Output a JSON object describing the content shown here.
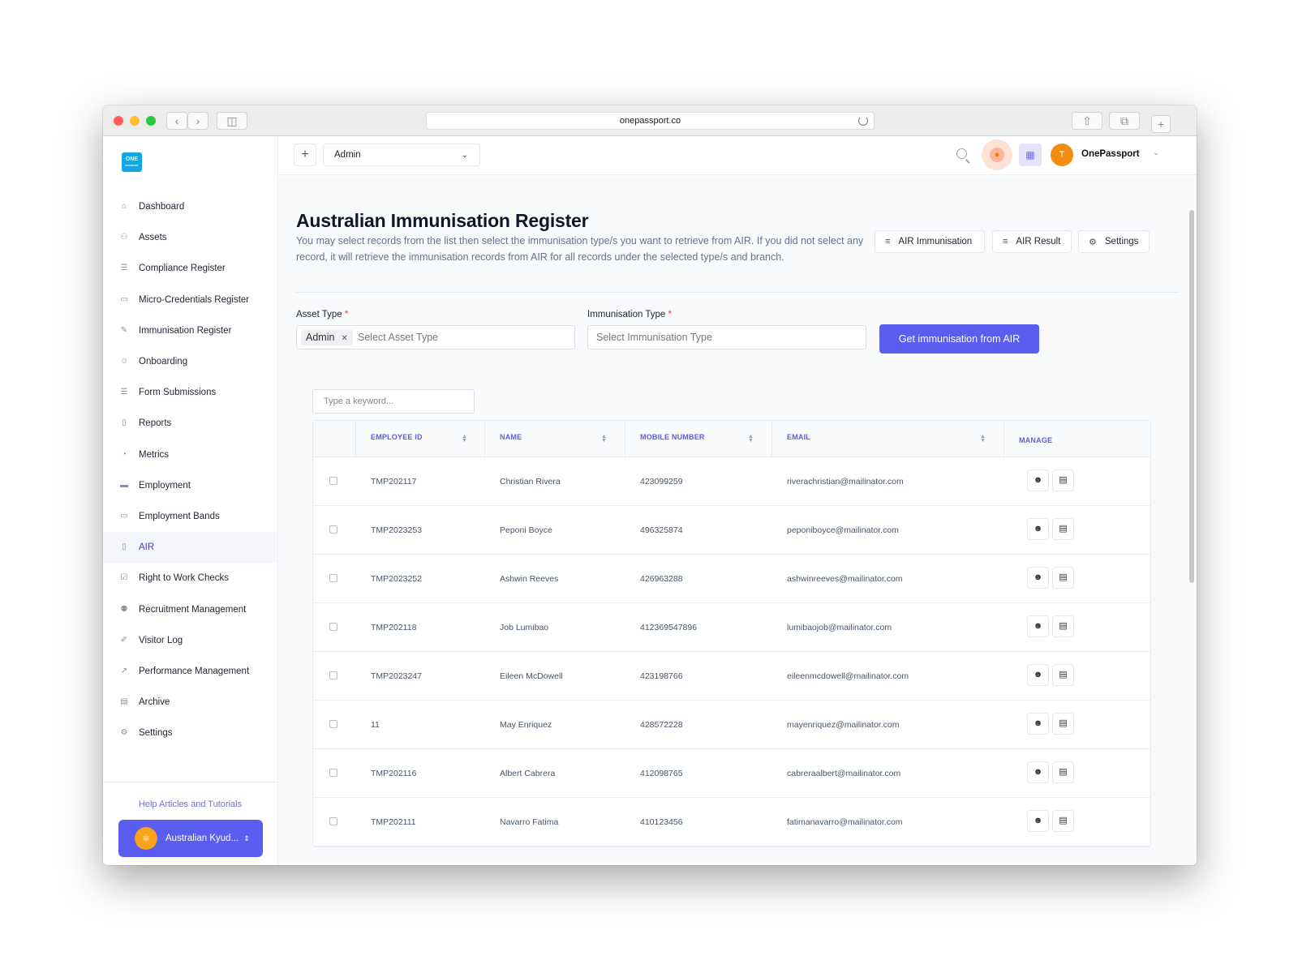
{
  "browser": {
    "url": "onepassport.co"
  },
  "logo": {
    "text": "ONE",
    "subtext": "PASSPORT"
  },
  "sidebar": {
    "items": [
      {
        "label": "Dashboard",
        "icon": "home-icon",
        "glyph": "⌂"
      },
      {
        "label": "Assets",
        "icon": "users-icon",
        "glyph": "⚇"
      },
      {
        "label": "Compliance Register",
        "icon": "list-icon",
        "glyph": "☰"
      },
      {
        "label": "Micro-Credentials Register",
        "icon": "card-icon",
        "glyph": "▭"
      },
      {
        "label": "Immunisation Register",
        "icon": "syringe-icon",
        "glyph": "✎"
      },
      {
        "label": "Onboarding",
        "icon": "user-plus-icon",
        "glyph": "☺"
      },
      {
        "label": "Form Submissions",
        "icon": "list-icon",
        "glyph": "☰"
      },
      {
        "label": "Reports",
        "icon": "document-icon",
        "glyph": "▯"
      },
      {
        "label": "Metrics",
        "icon": "pie-chart-icon",
        "glyph": "◔"
      },
      {
        "label": "Employment",
        "icon": "briefcase-icon",
        "glyph": "▬"
      },
      {
        "label": "Employment Bands",
        "icon": "briefcase-outline-icon",
        "glyph": "▭"
      },
      {
        "label": "AIR",
        "icon": "file-icon",
        "glyph": "▯"
      },
      {
        "label": "Right to Work Checks",
        "icon": "clipboard-check-icon",
        "glyph": "☑"
      },
      {
        "label": "Recruitment Management",
        "icon": "team-icon",
        "glyph": "⚉"
      },
      {
        "label": "Visitor Log",
        "icon": "pen-icon",
        "glyph": "✐"
      },
      {
        "label": "Performance Management",
        "icon": "line-chart-icon",
        "glyph": "↗"
      },
      {
        "label": "Archive",
        "icon": "archive-icon",
        "glyph": "▤"
      },
      {
        "label": "Settings",
        "icon": "gear-icon",
        "glyph": "⚙"
      }
    ],
    "active": "AIR",
    "help_link": "Help Articles and Tutorials",
    "org_name": "Australian Kyud..."
  },
  "topbar": {
    "plus": "+",
    "selector_value": "Admin",
    "user_initial": "T",
    "user_name": "OnePassport"
  },
  "page": {
    "title": "Australian Immunisation Register",
    "description": "You may select records from the list then select the immunisation type/s you want to retrieve from AIR. If you did not select any record, it will retrieve the immunisation records from AIR for all records under the selected type/s and branch.",
    "buttons": {
      "air_immunisation": "AIR Immunisation",
      "air_result": "AIR Result",
      "settings": "Settings"
    }
  },
  "form": {
    "asset_type_label": "Asset Type",
    "asset_type_chip": "Admin",
    "asset_type_placeholder": "Select Asset Type",
    "immunisation_type_label": "Immunisation Type",
    "immunisation_type_placeholder": "Select Immunisation Type",
    "required_mark": "*",
    "submit_label": "Get immunisation from AIR"
  },
  "search": {
    "placeholder": "Type a keyword..."
  },
  "table": {
    "headers": {
      "employee_id": "EMPLOYEE ID",
      "name": "NAME",
      "mobile": "MOBILE NUMBER",
      "email": "EMAIL",
      "manage": "MANAGE"
    },
    "rows": [
      {
        "id": "TMP202117",
        "name": "Christian Rivera",
        "mobile": "423099259",
        "email": "riverachristian@mailinator.com"
      },
      {
        "id": "TMP2023253",
        "name": "Peponi Boyce",
        "mobile": "496325874",
        "email": "peponiboyce@mailinator.com"
      },
      {
        "id": "TMP2023252",
        "name": "Ashwin Reeves",
        "mobile": "426963288",
        "email": "ashwinreeves@mailinator.com"
      },
      {
        "id": "TMP202118",
        "name": "Job Lumibao",
        "mobile": "412369547896",
        "email": "lumibaojob@mailinator.com"
      },
      {
        "id": "TMP2023247",
        "name": "Eileen McDowell",
        "mobile": "423198766",
        "email": "eileenmcdowell@mailinator.com"
      },
      {
        "id": "11",
        "name": "May Enriquez",
        "mobile": "428572228",
        "email": "mayenriquez@mailinator.com"
      },
      {
        "id": "TMP202116",
        "name": "Albert Cabrera",
        "mobile": "412098765",
        "email": "cabreraalbert@mailinator.com"
      },
      {
        "id": "TMP202111",
        "name": "Navarro Fatima",
        "mobile": "410123456",
        "email": "fatimanavarro@mailinator.com"
      }
    ]
  },
  "colors": {
    "accent": "#5a5df0",
    "notification": "#f97316",
    "avatar": "#f28c0f"
  }
}
